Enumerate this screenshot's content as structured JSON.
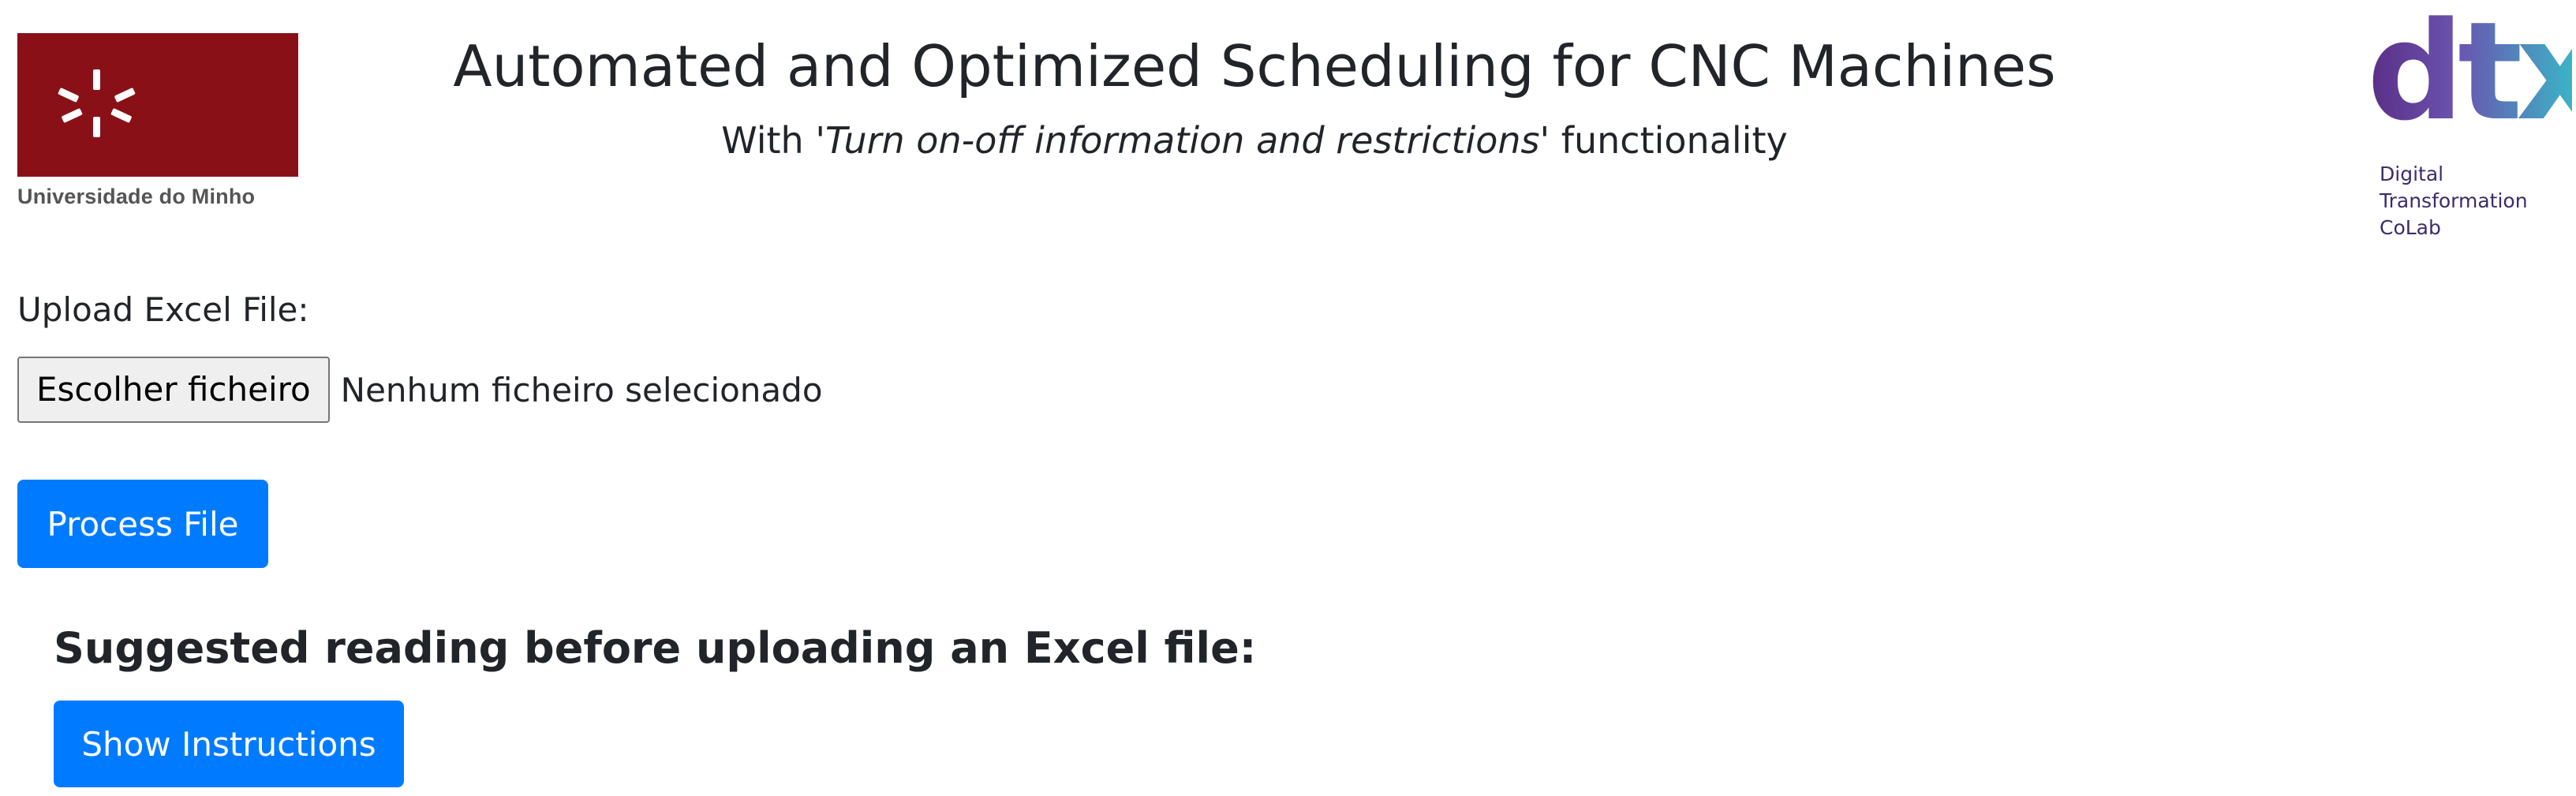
{
  "header": {
    "left_logo": {
      "icon": "uminho-emblem-icon",
      "caption": "Universidade do Minho",
      "brand_color": "#8a1017"
    },
    "title": "Automated and Optimized Scheduling for CNC Machines",
    "subtitle": {
      "prefix": "With '",
      "emphasis": "Turn on-off information and restrictions",
      "suffix": "' functionality"
    },
    "right_logo": {
      "mark": "dtx",
      "lines": [
        "Digital",
        "Transformation",
        "CoLab"
      ]
    }
  },
  "upload": {
    "label": "Upload Excel File:",
    "choose_button_label": "Escolher ficheiro",
    "status_text": "Nenhum ficheiro selecionado"
  },
  "actions": {
    "process_button_label": "Process File",
    "accent_color": "#007bff"
  },
  "instructions": {
    "heading": "Suggested reading before uploading an Excel file:",
    "show_button_label": "Show Instructions"
  }
}
